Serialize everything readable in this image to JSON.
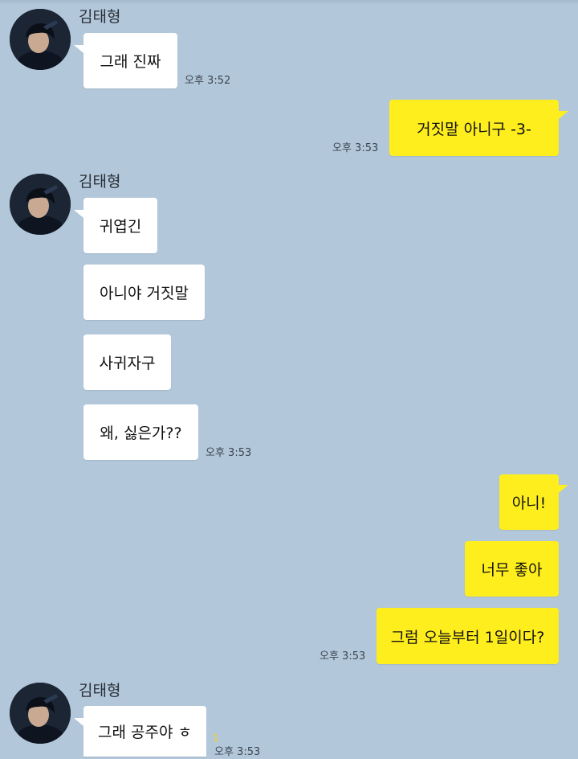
{
  "chat": {
    "sender_name": "김태형",
    "messages": [
      {
        "side": "in",
        "text": "그래 진짜",
        "time": "오후 3:52"
      },
      {
        "side": "out",
        "text": "거짓말 아니구 -3-",
        "time": "오후 3:53"
      },
      {
        "side": "in",
        "text": "귀엽긴"
      },
      {
        "side": "in",
        "text": "아니야 거짓말"
      },
      {
        "side": "in",
        "text": "사귀자구"
      },
      {
        "side": "in",
        "text": "왜, 싫은가??",
        "time": "오후 3:53"
      },
      {
        "side": "out",
        "text": "아니!"
      },
      {
        "side": "out",
        "text": "너무 좋아"
      },
      {
        "side": "out",
        "text": "그럼 오늘부터 1일이다?",
        "time": "오후 3:53"
      },
      {
        "side": "in",
        "text": "그래 공주야 ㅎ",
        "time": "오후 3:53",
        "unread": "1"
      }
    ]
  },
  "colors": {
    "background": "#b2c7da",
    "incoming_bubble": "#ffffff",
    "outgoing_bubble": "#ffee1e",
    "unread_count": "#f7d21a"
  },
  "icons": {
    "avatar": "profile-photo-avatar"
  }
}
